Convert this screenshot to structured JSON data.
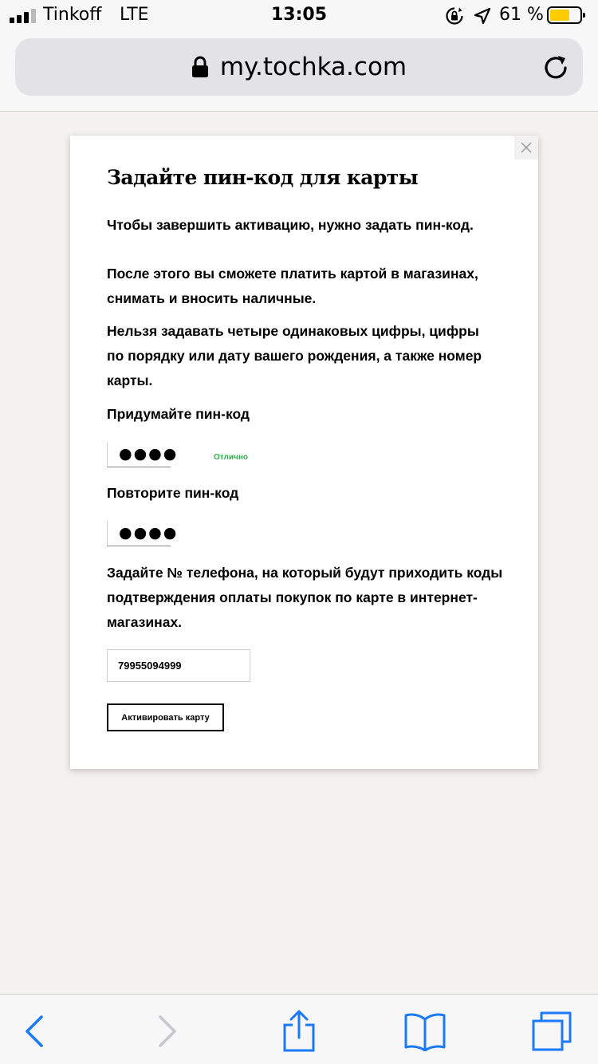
{
  "status_bar": {
    "carrier": "Tinkoff",
    "network": "LTE",
    "time": "13:05",
    "battery_percent": "61 %",
    "battery_level": 0.61,
    "battery_color": "#ffcc00"
  },
  "browser": {
    "url": "my.tochka.com"
  },
  "modal": {
    "title": "Задайте пин-код для карты",
    "intro": "Чтобы завершить активацию, нужно задать пин-код.",
    "after_text": "После этого вы сможете платить картой в магазинах, снимать и вносить наличные.",
    "rules_text": "Нельзя задавать четыре одинаковых цифры, цифры по порядку или дату вашего рождения, а также номер карты.",
    "pin_label": "Придумайте пин-код",
    "pin_value": "●●●●",
    "pin_status": "Отлично",
    "pin_status_color": "#2bb24c",
    "repeat_label": "Повторите пин-код",
    "repeat_value": "●●●●",
    "phone_text": "Задайте № телефона, на который будут приходить коды подтверждения оплаты покупок по карте в интернет-магазинах.",
    "phone_value": "79955094999",
    "activate_button": "Активировать карту"
  },
  "toolbar": {
    "accent_color": "#1a7af8",
    "disabled_color": "#c7c7cc"
  }
}
